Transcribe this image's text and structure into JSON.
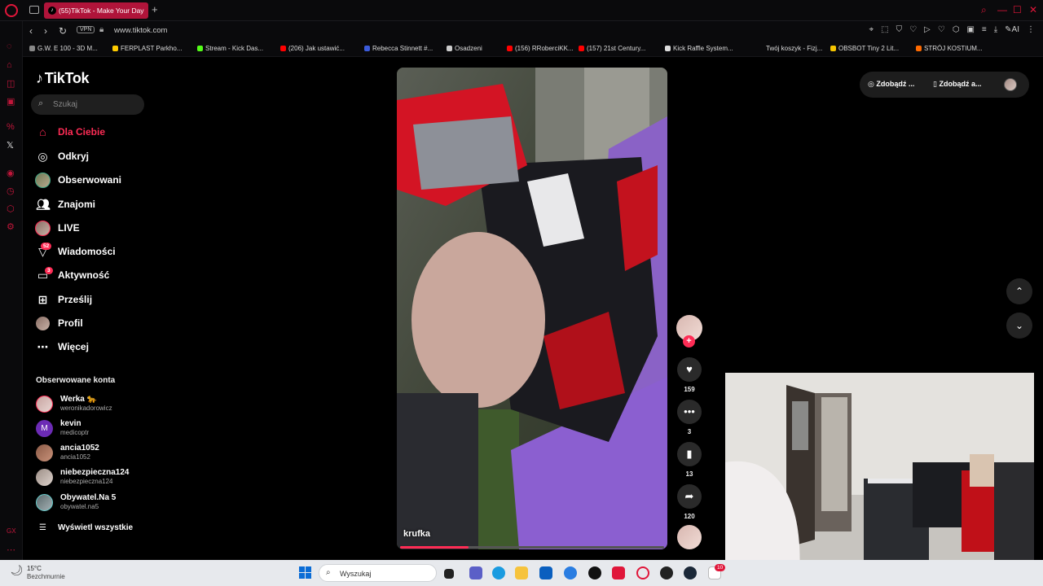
{
  "browser": {
    "tab_label": "(55)TikTok - Make Your Day",
    "tab_count": "55",
    "new_tab": "+",
    "vpn": "VPN",
    "url": "www.tiktok.com",
    "ai_label": "AI"
  },
  "bookmarks": [
    {
      "label": "G.W. E 100 - 3D M...",
      "color": "#888888"
    },
    {
      "label": "FERPLAST Parkho...",
      "color": "#ffcc00"
    },
    {
      "label": "Stream - Kick Das...",
      "color": "#53fc18"
    },
    {
      "label": "(206) Jak ustawić...",
      "color": "#ff0000"
    },
    {
      "label": "Rebecca Stinnett #...",
      "color": "#3b5bdb"
    },
    {
      "label": "Osadzeni",
      "color": "#cccccc"
    },
    {
      "label": "(156) RRoberciKK...",
      "color": "#ff0000"
    },
    {
      "label": "(157) 21st Century...",
      "color": "#ff0000"
    },
    {
      "label": "Kick Raffle System...",
      "color": "#dddddd"
    },
    {
      "label": "Twój koszyk - Fizj...",
      "color": "#0a0a0c"
    },
    {
      "label": "OBSBOT Tiny 2 Lit...",
      "color": "#f5c400"
    },
    {
      "label": "STRÓJ KOSTIUM...",
      "color": "#ff6a00"
    }
  ],
  "tiktok": {
    "logo": "TikTok",
    "search_placeholder": "Szukaj",
    "menu": [
      {
        "label": "Dla Ciebie",
        "icon": "home-icon"
      },
      {
        "label": "Odkryj",
        "icon": "compass-icon"
      },
      {
        "label": "Obserwowani",
        "icon": "following-avatar"
      },
      {
        "label": "Znajomi",
        "icon": "friends-icon"
      },
      {
        "label": "LIVE",
        "icon": "live-avatar"
      },
      {
        "label": "Wiadomości",
        "icon": "messages-icon",
        "badge": "52"
      },
      {
        "label": "Aktywność",
        "icon": "activity-icon",
        "badge": "3"
      },
      {
        "label": "Prześlij",
        "icon": "upload-icon"
      },
      {
        "label": "Profil",
        "icon": "profile-avatar"
      },
      {
        "label": "Więcej",
        "icon": "more-icon"
      }
    ],
    "followed_title": "Obserwowane konta",
    "accounts": [
      {
        "name": "Werka 🐆",
        "handle": "weronikadorowicz"
      },
      {
        "name": "kevin",
        "handle": "medicoptr",
        "initial": "M"
      },
      {
        "name": "ancia1052",
        "handle": "ancia1052"
      },
      {
        "name": "niebezpieczna124",
        "handle": "niebezpieczna124"
      },
      {
        "name": "Obywatel.Na 5",
        "handle": "obywatel.na5"
      }
    ],
    "show_all": "Wyświetl wszystkie",
    "get_app_1": "Zdobądź ...",
    "get_app_2": "Zdobądź a...",
    "video": {
      "author": "krufka",
      "likes": "159",
      "comments": "3",
      "saves": "13",
      "shares": "120",
      "progress": 0.26
    }
  },
  "taskbar": {
    "temp": "15°C",
    "weather": "Bezchmurnie",
    "search_placeholder": "Wyszukaj",
    "notif_badge": "10"
  }
}
